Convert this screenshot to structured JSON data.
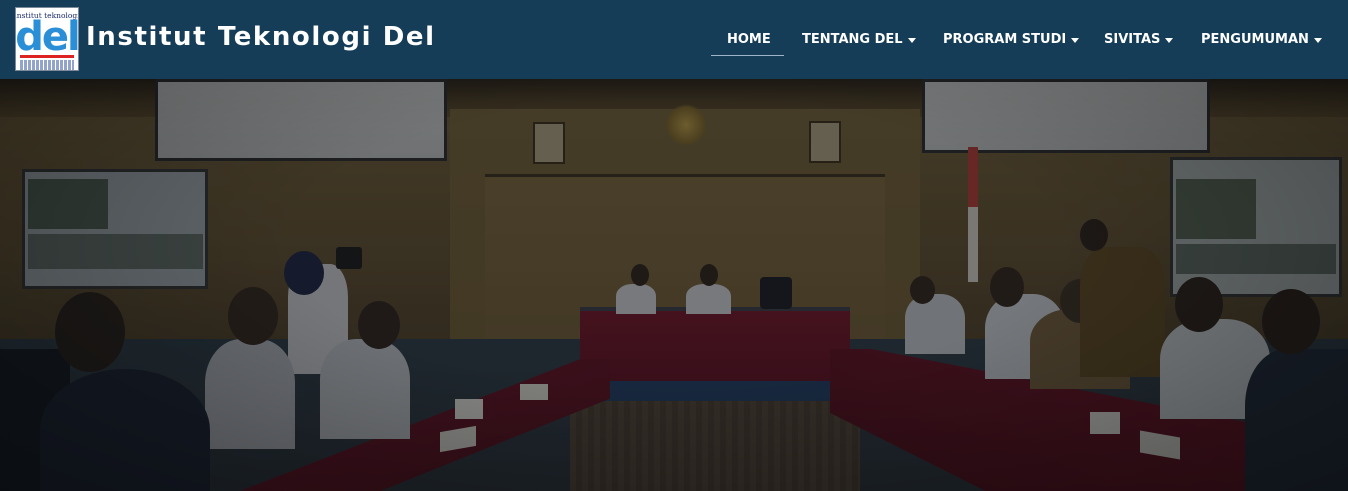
{
  "logo": {
    "top_text": "institut teknologi",
    "wordmark": "del",
    "colors": {
      "wordmark": "#2a8fd6",
      "accent": "#dd2222",
      "ink": "#1a2a6a"
    }
  },
  "brand": {
    "title": "Institut Teknologi Del"
  },
  "nav": {
    "background": "#153d57",
    "items": [
      {
        "label": "HOME",
        "active": true,
        "has_dropdown": false
      },
      {
        "label": "TENTANG DEL",
        "active": false,
        "has_dropdown": true
      },
      {
        "label": "PROGRAM STUDI",
        "active": false,
        "has_dropdown": true
      },
      {
        "label": "SIVITAS",
        "active": false,
        "has_dropdown": true
      },
      {
        "label": "PENGUMUMAN",
        "active": false,
        "has_dropdown": true
      }
    ],
    "dropdown_icon": "caret-down-icon"
  },
  "hero": {
    "image": "meeting-room-photo",
    "overlay": "dark"
  }
}
